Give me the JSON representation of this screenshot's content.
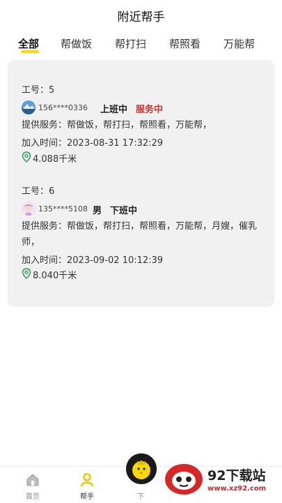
{
  "header": {
    "title": "附近帮手"
  },
  "tabs": [
    {
      "label": "全部",
      "active": true
    },
    {
      "label": "帮做饭",
      "active": false
    },
    {
      "label": "帮打扫",
      "active": false
    },
    {
      "label": "帮照看",
      "active": false
    },
    {
      "label": "万能帮",
      "active": false
    }
  ],
  "accent_color": "#f5d90a",
  "helpers": [
    {
      "job_no": "工号：5",
      "phone": "156****0336",
      "gender": "",
      "work_status": "上班中",
      "service_status": "服务中",
      "service_status_color": "#d32f2f",
      "services": "提供服务：帮做饭，帮打扫，帮照看，万能帮，",
      "join_time": "加入时间：2023-08-31 17:32:29",
      "distance": "4.088千米",
      "avatar": "landscape-avatar"
    },
    {
      "job_no": "工号：6",
      "phone": "135****5108",
      "gender": "男",
      "work_status": "下班中",
      "service_status": "",
      "services": "提供服务：帮做饭，帮打扫，帮照看，万能帮，月嫂，催乳师，",
      "join_time": "加入时间：2023-09-02 10:12:39",
      "distance": "8.040千米",
      "avatar": "cartoon-girl-avatar"
    }
  ],
  "tabbar": {
    "items": [
      {
        "label": "首页",
        "icon": "home-icon"
      },
      {
        "label": "帮手",
        "icon": "helper-icon",
        "active": true
      },
      {
        "label": "下",
        "icon": "center-fab-icon"
      }
    ]
  },
  "watermark": {
    "line1": "92下载站",
    "line2": "www.xz92.com"
  }
}
